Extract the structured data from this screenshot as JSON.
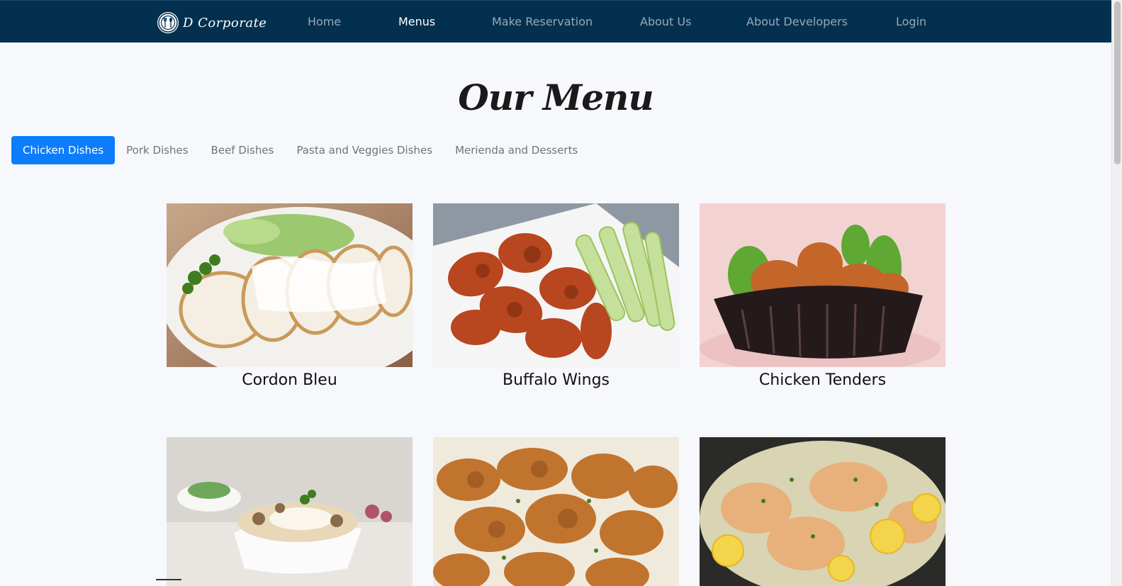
{
  "brand": {
    "name": "D Corporate",
    "logo_icon": "fork-spoon-plate-icon"
  },
  "nav": {
    "items": [
      {
        "label": "Home",
        "active": false
      },
      {
        "label": "Menus",
        "active": true
      },
      {
        "label": "Make Reservation",
        "active": false
      },
      {
        "label": "About Us",
        "active": false
      },
      {
        "label": "About Developers",
        "active": false
      },
      {
        "label": "Login",
        "active": false
      }
    ]
  },
  "page": {
    "title": "Our Menu"
  },
  "tabs": [
    {
      "label": "Chicken Dishes",
      "active": true
    },
    {
      "label": "Pork Dishes",
      "active": false
    },
    {
      "label": "Beef Dishes",
      "active": false
    },
    {
      "label": "Pasta and Veggies Dishes",
      "active": false
    },
    {
      "label": "Merienda and Desserts",
      "active": false
    }
  ],
  "dishes": [
    {
      "name": "Cordon Bleu"
    },
    {
      "name": "Buffalo Wings"
    },
    {
      "name": "Chicken Tenders"
    },
    {
      "name": ""
    },
    {
      "name": ""
    },
    {
      "name": ""
    }
  ],
  "colors": {
    "navbar": "#03304f",
    "accent": "#0d7dfb",
    "background": "#f7f8fc"
  }
}
